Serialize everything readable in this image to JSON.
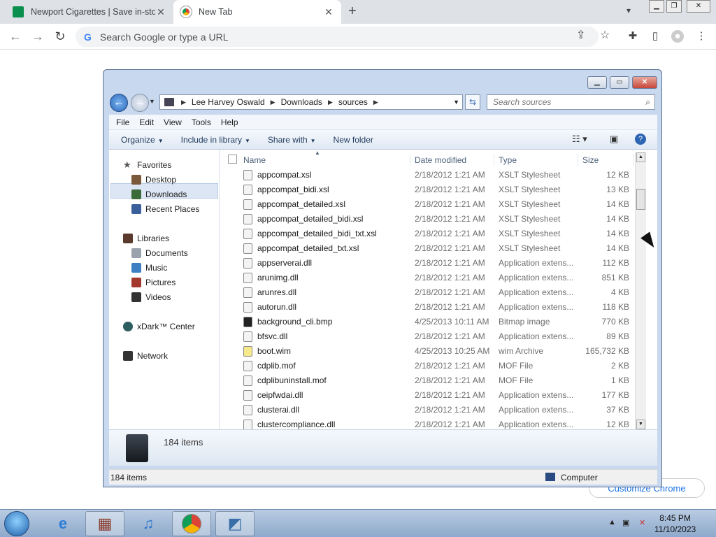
{
  "browser": {
    "tabs": [
      {
        "title": "Newport Cigarettes | Save in-store",
        "favicon": "newport-favicon"
      },
      {
        "title": "New Tab",
        "favicon": "chrome-favicon"
      }
    ],
    "omnibox_placeholder": "Search Google or type a URL",
    "customize_label": "Customize Chrome"
  },
  "explorer": {
    "breadcrumb": [
      "Lee Harvey Oswald",
      "Downloads",
      "sources"
    ],
    "search_placeholder": "Search sources",
    "menu": [
      "File",
      "Edit",
      "View",
      "Tools",
      "Help"
    ],
    "commands": {
      "organize": "Organize",
      "include_library": "Include in library",
      "share_with": "Share with",
      "new_folder": "New folder"
    },
    "nav": {
      "favorites": "Favorites",
      "desktop": "Desktop",
      "downloads": "Downloads",
      "recent_places": "Recent Places",
      "libraries": "Libraries",
      "documents": "Documents",
      "music": "Music",
      "pictures": "Pictures",
      "videos": "Videos",
      "xdark": "xDark™ Center",
      "network": "Network"
    },
    "columns": {
      "name": "Name",
      "date": "Date modified",
      "type": "Type",
      "size": "Size"
    },
    "files": [
      {
        "name": "appcompat.xsl",
        "date": "2/18/2012 1:21 AM",
        "type": "XSLT Stylesheet",
        "size": "12 KB"
      },
      {
        "name": "appcompat_bidi.xsl",
        "date": "2/18/2012 1:21 AM",
        "type": "XSLT Stylesheet",
        "size": "13 KB"
      },
      {
        "name": "appcompat_detailed.xsl",
        "date": "2/18/2012 1:21 AM",
        "type": "XSLT Stylesheet",
        "size": "14 KB"
      },
      {
        "name": "appcompat_detailed_bidi.xsl",
        "date": "2/18/2012 1:21 AM",
        "type": "XSLT Stylesheet",
        "size": "14 KB"
      },
      {
        "name": "appcompat_detailed_bidi_txt.xsl",
        "date": "2/18/2012 1:21 AM",
        "type": "XSLT Stylesheet",
        "size": "14 KB"
      },
      {
        "name": "appcompat_detailed_txt.xsl",
        "date": "2/18/2012 1:21 AM",
        "type": "XSLT Stylesheet",
        "size": "14 KB"
      },
      {
        "name": "appserverai.dll",
        "date": "2/18/2012 1:21 AM",
        "type": "Application extens...",
        "size": "112 KB"
      },
      {
        "name": "arunimg.dll",
        "date": "2/18/2012 1:21 AM",
        "type": "Application extens...",
        "size": "851 KB"
      },
      {
        "name": "arunres.dll",
        "date": "2/18/2012 1:21 AM",
        "type": "Application extens...",
        "size": "4 KB"
      },
      {
        "name": "autorun.dll",
        "date": "2/18/2012 1:21 AM",
        "type": "Application extens...",
        "size": "118 KB"
      },
      {
        "name": "background_cli.bmp",
        "date": "4/25/2013 10:11 AM",
        "type": "Bitmap image",
        "size": "770 KB"
      },
      {
        "name": "bfsvc.dll",
        "date": "2/18/2012 1:21 AM",
        "type": "Application extens...",
        "size": "89 KB"
      },
      {
        "name": "boot.wim",
        "date": "4/25/2013 10:25 AM",
        "type": "wim Archive",
        "size": "165,732 KB"
      },
      {
        "name": "cdplib.mof",
        "date": "2/18/2012 1:21 AM",
        "type": "MOF File",
        "size": "2 KB"
      },
      {
        "name": "cdplibuninstall.mof",
        "date": "2/18/2012 1:21 AM",
        "type": "MOF File",
        "size": "1 KB"
      },
      {
        "name": "ceipfwdai.dll",
        "date": "2/18/2012 1:21 AM",
        "type": "Application extens...",
        "size": "177 KB"
      },
      {
        "name": "clusterai.dll",
        "date": "2/18/2012 1:21 AM",
        "type": "Application extens...",
        "size": "37 KB"
      },
      {
        "name": "clustercompliance.dll",
        "date": "2/18/2012 1:21 AM",
        "type": "Application extens...",
        "size": "12 KB"
      }
    ],
    "details_count": "184 items",
    "status_count": "184 items",
    "status_location": "Computer"
  },
  "taskbar": {
    "time": "8:45 PM",
    "date": "11/10/2023"
  }
}
